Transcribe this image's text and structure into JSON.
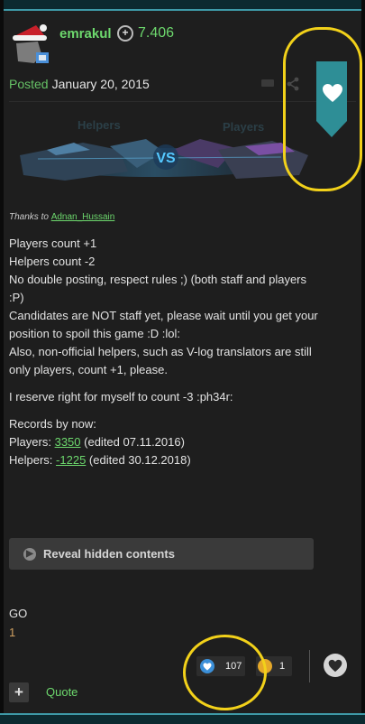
{
  "post": {
    "username": "emrakul",
    "reputation": "7.406",
    "posted_label": "Posted",
    "posted_date": "January 20, 2015"
  },
  "banner": {
    "left_label": "Helpers",
    "right_label": "Players",
    "center_text": "VS"
  },
  "thanks": {
    "prefix": "Thanks to",
    "name": "Adnan_Hussain"
  },
  "body": {
    "lines": [
      "Players count +1",
      "Helpers count -2",
      "No double posting, respect rules ;) (both staff and players :P)",
      "Candidates are NOT staff yet, please wait until you get your position to spoil this game :D :lol:",
      "Also, non-official helpers, such as V-log translators are still only players, count +1, please."
    ],
    "reserve": "I reserve right for myself to count -3 :ph34r:",
    "records_title": "Records by now:",
    "players_label": "Players:",
    "players_value": "3350",
    "players_note": "(edited 07.11.2016)",
    "helpers_label": "Helpers:",
    "helpers_value": "-1225",
    "helpers_note": "(edited 30.12.2018)"
  },
  "hidden": {
    "label": "Reveal hidden contents"
  },
  "reply": {
    "text": "GO",
    "count": "1"
  },
  "reactions": {
    "like_count": "107",
    "haha_count": "1"
  },
  "footer": {
    "quote_label": "Quote",
    "plus_label": "+"
  },
  "colors": {
    "accent_green": "#6dd86d",
    "ribbon_teal": "#2e8e96",
    "highlight_yellow": "#f2d11a"
  }
}
